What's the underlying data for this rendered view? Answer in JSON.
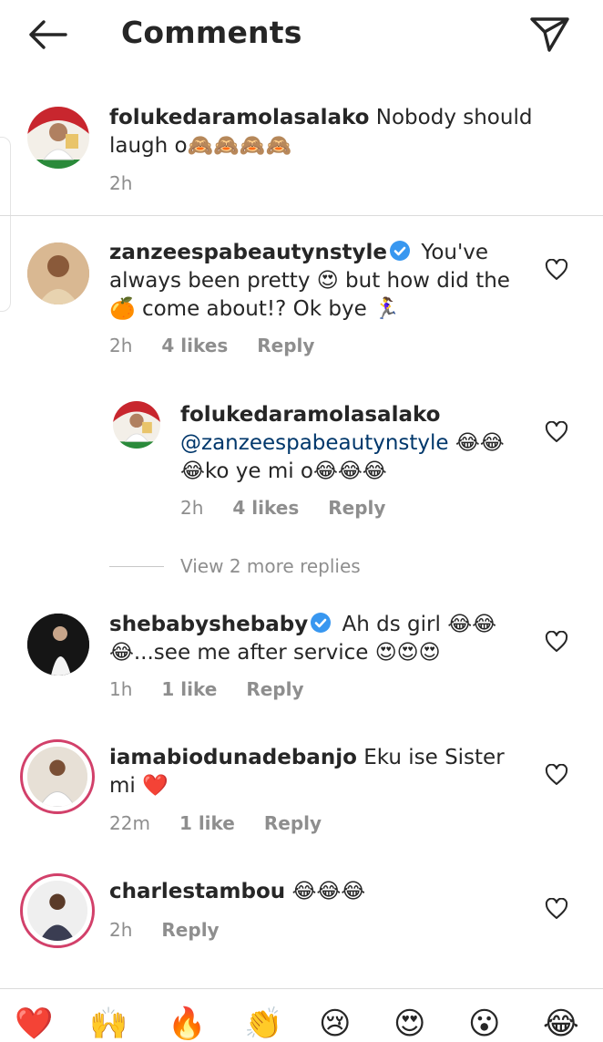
{
  "header": {
    "title": "Comments"
  },
  "comments": [
    {
      "username": "folukedaramolasalako",
      "text": " Nobody should laugh o🙈🙈🙈🙈",
      "time": "2h"
    },
    {
      "username": "zanzeespabeautynstyle",
      "text": " You've always been pretty 😍 but how did the 🍊 come about!? Ok bye 🏃‍♀️",
      "time": "2h",
      "likes": "4 likes",
      "reply": "Reply"
    },
    {
      "username": "folukedaramolasalako",
      "mention": "@zanzeespabeautynstyle",
      "text": " 😂😂😂ko ye mi o😂😂😂",
      "time": "2h",
      "likes": "4 likes",
      "reply": "Reply"
    },
    {
      "username": "shebabyshebaby",
      "text": " Ah ds girl 😂😂😂...see me after service 😍😍😍",
      "time": "1h",
      "likes": "1 like",
      "reply": "Reply"
    },
    {
      "username": "iamabiodunadebanjo",
      "text": " Eku ise Sister mi ❤️",
      "time": "22m",
      "likes": "1 like",
      "reply": "Reply"
    },
    {
      "username": "charlestambou",
      "text": " 😂😂😂",
      "time": "2h",
      "reply": "Reply"
    }
  ],
  "view_more": "View 2 more replies",
  "emoji_bar": [
    "❤️",
    "🙌",
    "🔥",
    "👏",
    "😢",
    "😍",
    "😮",
    "😂"
  ],
  "colors": {
    "text": "#262626",
    "muted": "#8e8e8e",
    "mention": "#00376b",
    "story_ring": "#d2406a",
    "verified": "#3897f0"
  },
  "icons": {
    "back": "arrow-left-icon",
    "send": "paper-plane-icon",
    "like": "heart-outline-icon",
    "verified": "verified-badge-icon"
  }
}
